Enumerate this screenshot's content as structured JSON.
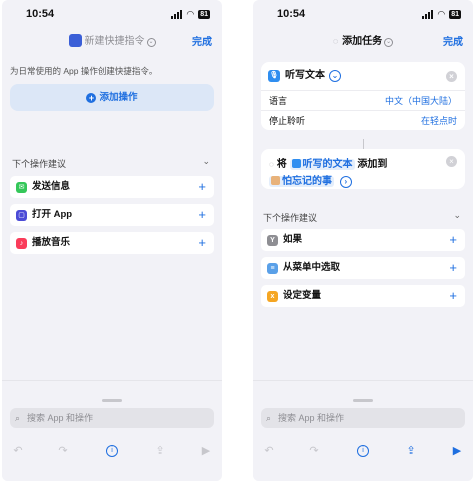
{
  "status": {
    "time": "10:54",
    "battery": "81"
  },
  "left": {
    "nav": {
      "title": "新建快捷指令",
      "done": "完成"
    },
    "hint": "为日常使用的 App 操作创建快捷指令。",
    "add_action": "添加操作",
    "suggestions_header": "下个操作建议",
    "suggestions": [
      {
        "label": "发送信息",
        "icon": "message-icon",
        "color": "#34c759"
      },
      {
        "label": "打开 App",
        "icon": "app-icon",
        "color": "#4b4bd6"
      },
      {
        "label": "播放音乐",
        "icon": "music-icon",
        "color": "#fa3c5a"
      }
    ],
    "search_placeholder": "搜索 App 和操作"
  },
  "right": {
    "nav": {
      "title": "添加任务",
      "done": "完成"
    },
    "dictate_card": {
      "title": "听写文本",
      "rows": [
        {
          "label": "语言",
          "value": "中文（中国大陆）"
        },
        {
          "label": "停止聆听",
          "value": "在轻点时"
        }
      ]
    },
    "add_card": {
      "word_will": "将",
      "variable": "听写的文本",
      "word_add_to": "添加到",
      "target": "怕忘记的事"
    },
    "suggestions_header": "下个操作建议",
    "suggestions": [
      {
        "label": "如果",
        "icon": "if-icon",
        "color": "#8e8e93"
      },
      {
        "label": "从菜单中选取",
        "icon": "menu-icon",
        "color": "#5aa0e8"
      },
      {
        "label": "设定变量",
        "icon": "variable-icon",
        "color": "#f5a623"
      }
    ],
    "search_placeholder": "搜索 App 和操作"
  },
  "colors": {
    "accent": "#1f6fe0",
    "background": "#f2f2f7"
  }
}
